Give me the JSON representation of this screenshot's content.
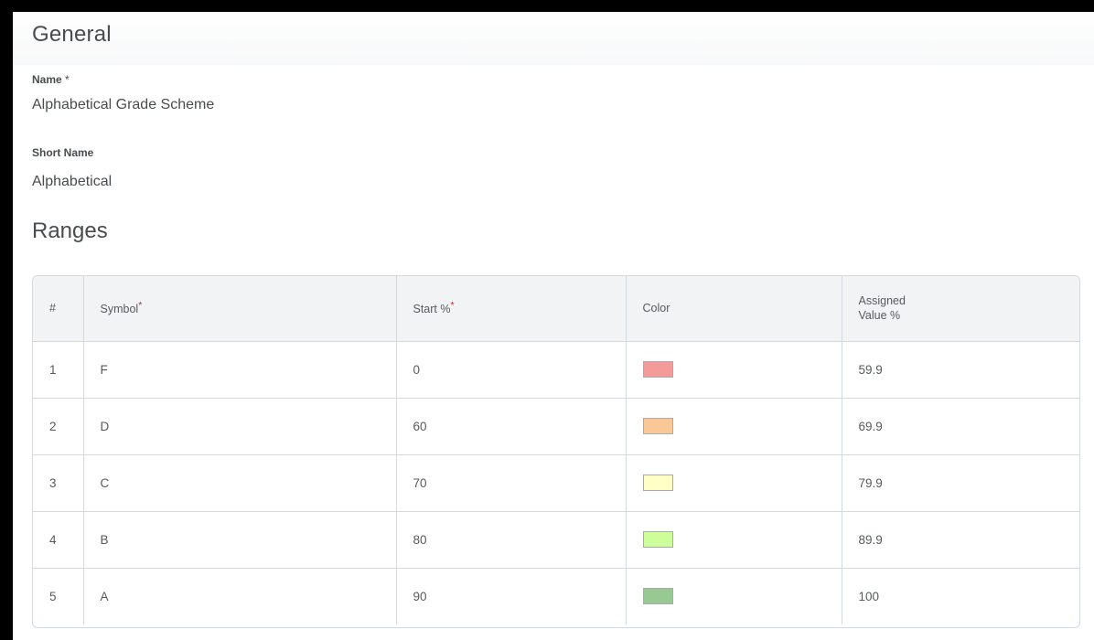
{
  "general": {
    "heading": "General",
    "name_label": "Name",
    "name_required_marker": "*",
    "name_value": "Alphabetical Grade Scheme",
    "short_name_label": "Short Name",
    "short_name_value": "Alphabetical"
  },
  "ranges": {
    "heading": "Ranges",
    "columns": {
      "num": "#",
      "symbol": "Symbol",
      "start": "Start %",
      "color": "Color",
      "assigned_line1": "Assigned",
      "assigned_line2": "Value %",
      "required_marker": "*"
    },
    "rows": [
      {
        "num": "1",
        "symbol": "F",
        "start": "0",
        "color": "#f49a9a",
        "assigned": "59.9"
      },
      {
        "num": "2",
        "symbol": "D",
        "start": "60",
        "color": "#f9c896",
        "assigned": "69.9"
      },
      {
        "num": "3",
        "symbol": "C",
        "start": "70",
        "color": "#ffffc6",
        "assigned": "79.9"
      },
      {
        "num": "4",
        "symbol": "B",
        "start": "80",
        "color": "#ccff99",
        "assigned": "89.9"
      },
      {
        "num": "5",
        "symbol": "A",
        "start": "90",
        "color": "#99c993",
        "assigned": "100"
      }
    ]
  }
}
